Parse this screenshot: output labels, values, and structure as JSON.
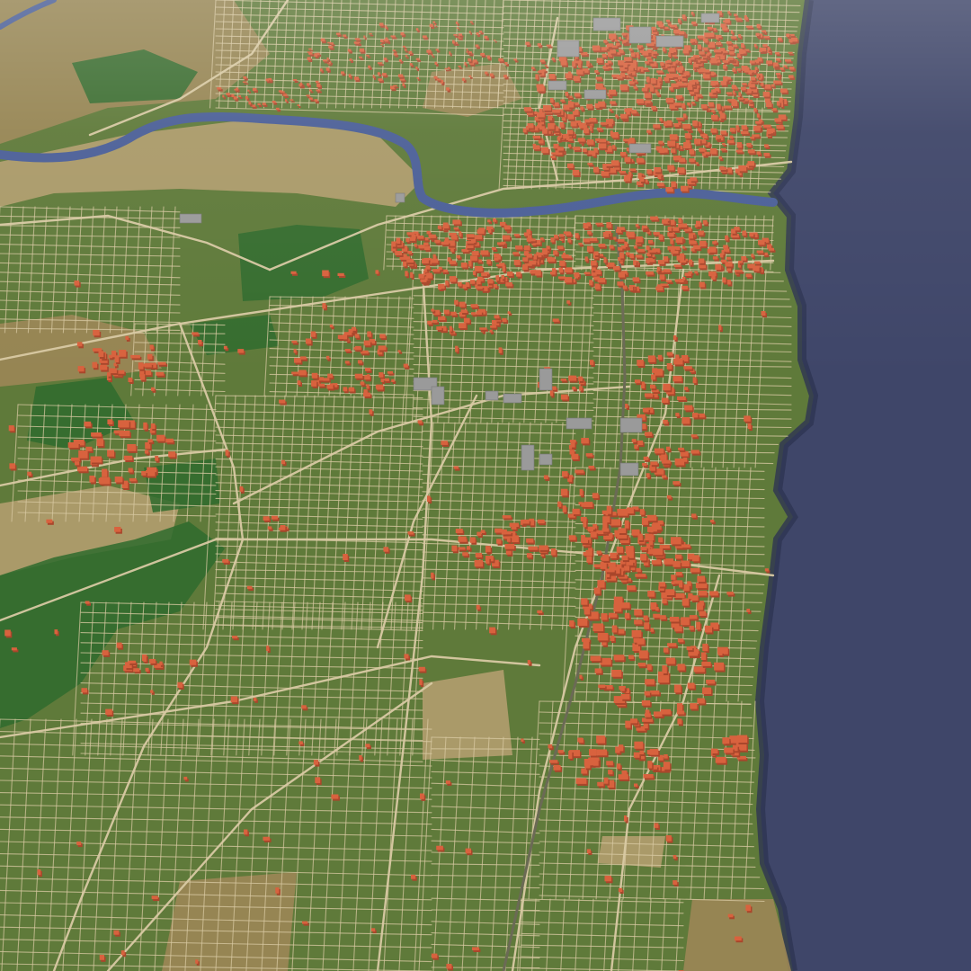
{
  "scene": {
    "view": "oblique-3d-terrain",
    "labels_visible": false
  },
  "colors": {
    "sea": "#3f4669",
    "sea_shadow": "#2e3452",
    "grass": "#5f7a3a",
    "grass_dark": "#3f6f32",
    "forest": "#2f6b2e",
    "farmland": "#9c8657",
    "sand": "#b39d6f",
    "river": "#4b5f97",
    "road": "#d8c9a3",
    "building": "#d8623e",
    "building_shade": "#a9462b",
    "industrial": "#9a9a9a"
  },
  "features": {
    "coastline": "east",
    "river": "river-north-flowing-east-into-sea",
    "urban_core": "north-east",
    "rail_line": "north-south"
  }
}
